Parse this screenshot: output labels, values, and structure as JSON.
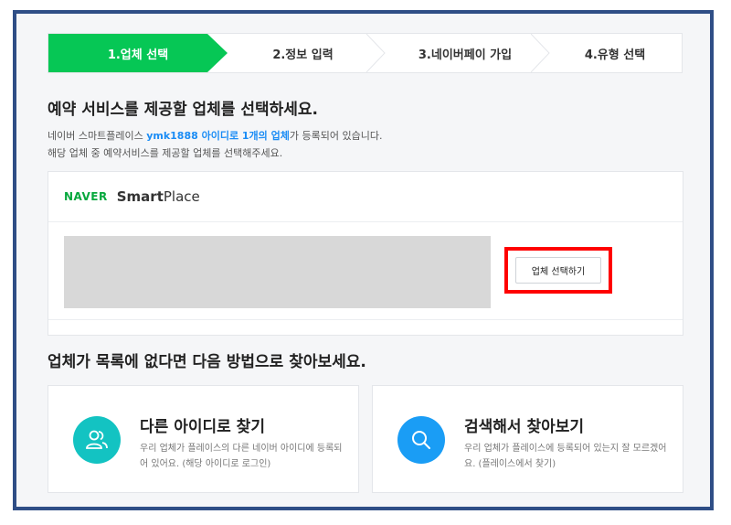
{
  "stepper": {
    "steps": [
      {
        "label": "1.업체 선택",
        "active": true
      },
      {
        "label": "2.정보 입력",
        "active": false
      },
      {
        "label": "3.네이버페이 가입",
        "active": false
      },
      {
        "label": "4.유형 선택",
        "active": false
      }
    ]
  },
  "main": {
    "heading": "예약 서비스를 제공할 업체를 선택하세요.",
    "desc_prefix": "네이버 스마트플레이스 ",
    "desc_highlight": "ymk1888 아이디로 1개의 업체",
    "desc_suffix": "가 등록되어 있습니다.",
    "desc_line2": "해당 업체 중 예약서비스를 제공할 업체를 선택해주세요."
  },
  "card": {
    "logo_naver": "NAVER",
    "logo_smart": "Smart",
    "logo_place": "Place",
    "select_button": "업체 선택하기"
  },
  "alt": {
    "heading": "업체가 목록에 없다면 다음 방법으로 찾아보세요.",
    "options": [
      {
        "title": "다른 아이디로 찾기",
        "text": "우리 업체가 플레이스의 다른 네이버 아이디에 등록되어 있어요. (해당 아이디로 로그인)",
        "icon": "users-icon",
        "color": "#13c3c2"
      },
      {
        "title": "검색해서 찾아보기",
        "text": "우리 업체가 플레이스에 등록되어 있는지 잘 모르겠어요. (플레이스에서 찾기)",
        "icon": "search-icon",
        "color": "#1a9df5"
      }
    ]
  },
  "colors": {
    "accent": "#06c755",
    "link": "#1a8cf5",
    "highlight_border": "#ff0000",
    "frame": "#2f4e86"
  }
}
